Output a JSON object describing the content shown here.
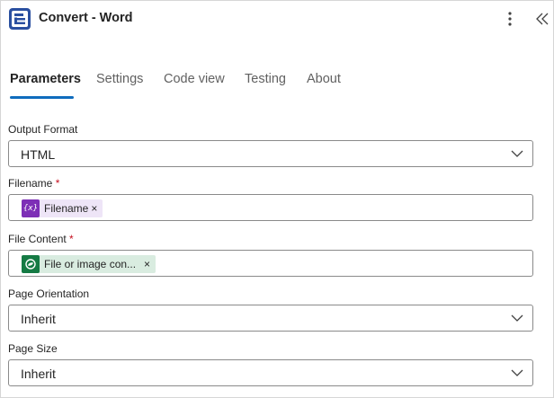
{
  "header": {
    "title": "Convert - Word",
    "icons": {
      "app": "app-logo-icon",
      "more": "more-vertical-icon",
      "collapse": "double-chevron-left-icon"
    }
  },
  "tabs": [
    {
      "label": "Parameters",
      "active": true
    },
    {
      "label": "Settings",
      "active": false
    },
    {
      "label": "Code view",
      "active": false
    },
    {
      "label": "Testing",
      "active": false
    },
    {
      "label": "About",
      "active": false
    }
  ],
  "fields": {
    "output_format": {
      "label": "Output Format",
      "value": "HTML"
    },
    "filename": {
      "label": "Filename",
      "required_mark": "*",
      "token_label": "Filename",
      "token_remove": "×",
      "token_icon_text": "{x}"
    },
    "file_content": {
      "label": "File Content",
      "required_mark": "*",
      "token_label": "File or image con...",
      "token_remove": "×"
    },
    "page_orientation": {
      "label": "Page Orientation",
      "value": "Inherit"
    },
    "page_size": {
      "label": "Page Size",
      "value": "Inherit"
    }
  },
  "colors": {
    "accent": "#0f6cbd",
    "required": "#c50f1f",
    "variable_token_bg": "#eee5f7",
    "variable_token_icon": "#7d2fb6",
    "file_token_bg": "#d9ece0",
    "file_token_icon": "#157a44",
    "app_icon": "#2a4fa0"
  }
}
